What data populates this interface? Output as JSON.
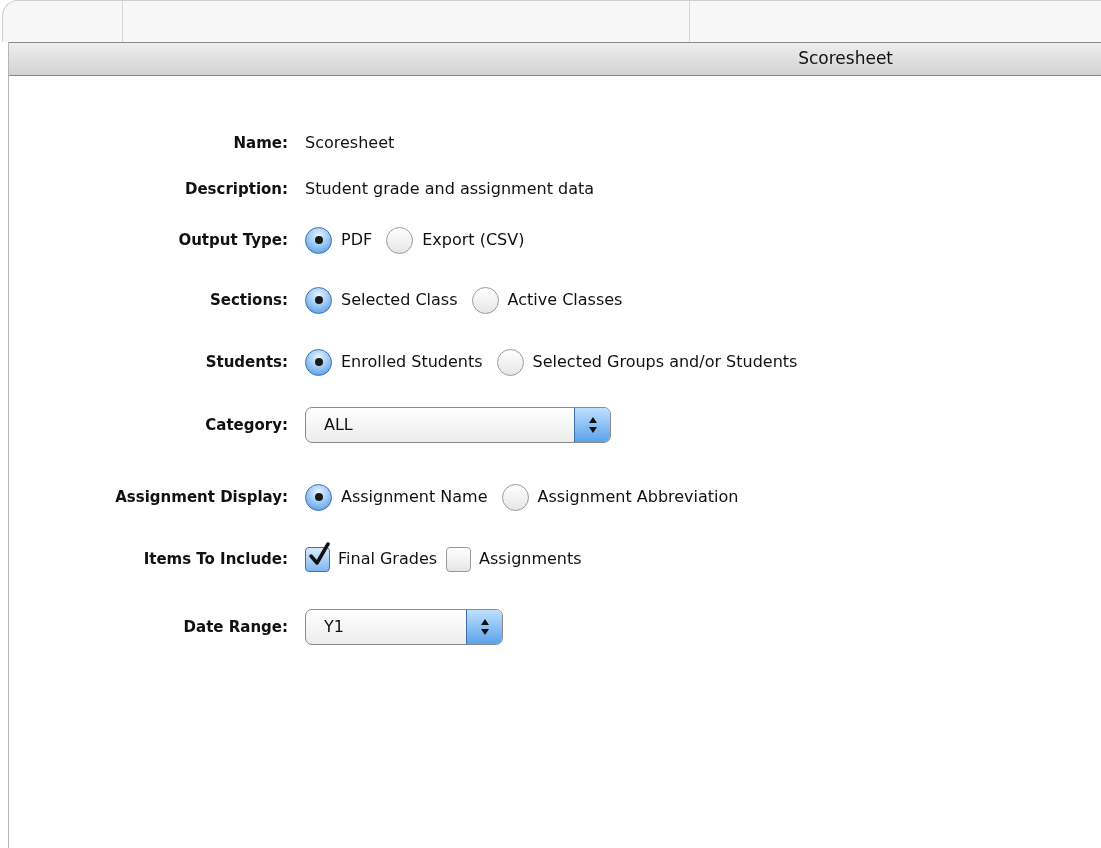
{
  "window": {
    "title": "Scoresheet"
  },
  "fields": [
    {
      "kind": "text",
      "label": "Name:",
      "value": "Scoresheet"
    },
    {
      "kind": "text",
      "label": "Description:",
      "value": "Student grade and assignment data"
    },
    {
      "kind": "radio",
      "label": "Output Type:",
      "options": [
        {
          "label": "PDF",
          "selected": true
        },
        {
          "label": "Export (CSV)",
          "selected": false
        }
      ]
    },
    {
      "kind": "radio",
      "label": "Sections:",
      "options": [
        {
          "label": "Selected Class",
          "selected": true
        },
        {
          "label": "Active Classes",
          "selected": false
        }
      ]
    },
    {
      "kind": "radio",
      "label": "Students:",
      "options": [
        {
          "label": "Enrolled Students",
          "selected": true
        },
        {
          "label": "Selected Groups and/or Students",
          "selected": false
        }
      ]
    },
    {
      "kind": "select",
      "label": "Category:",
      "value": "ALL"
    },
    {
      "kind": "radio",
      "label": "Assignment Display:",
      "options": [
        {
          "label": "Assignment Name",
          "selected": true
        },
        {
          "label": "Assignment Abbreviation",
          "selected": false
        }
      ]
    },
    {
      "kind": "checkbox",
      "label": "Items To Include:",
      "options": [
        {
          "label": "Final Grades",
          "checked": true
        },
        {
          "label": "Assignments",
          "checked": false
        }
      ]
    },
    {
      "kind": "select",
      "label": "Date Range:",
      "value": "Y1"
    }
  ]
}
